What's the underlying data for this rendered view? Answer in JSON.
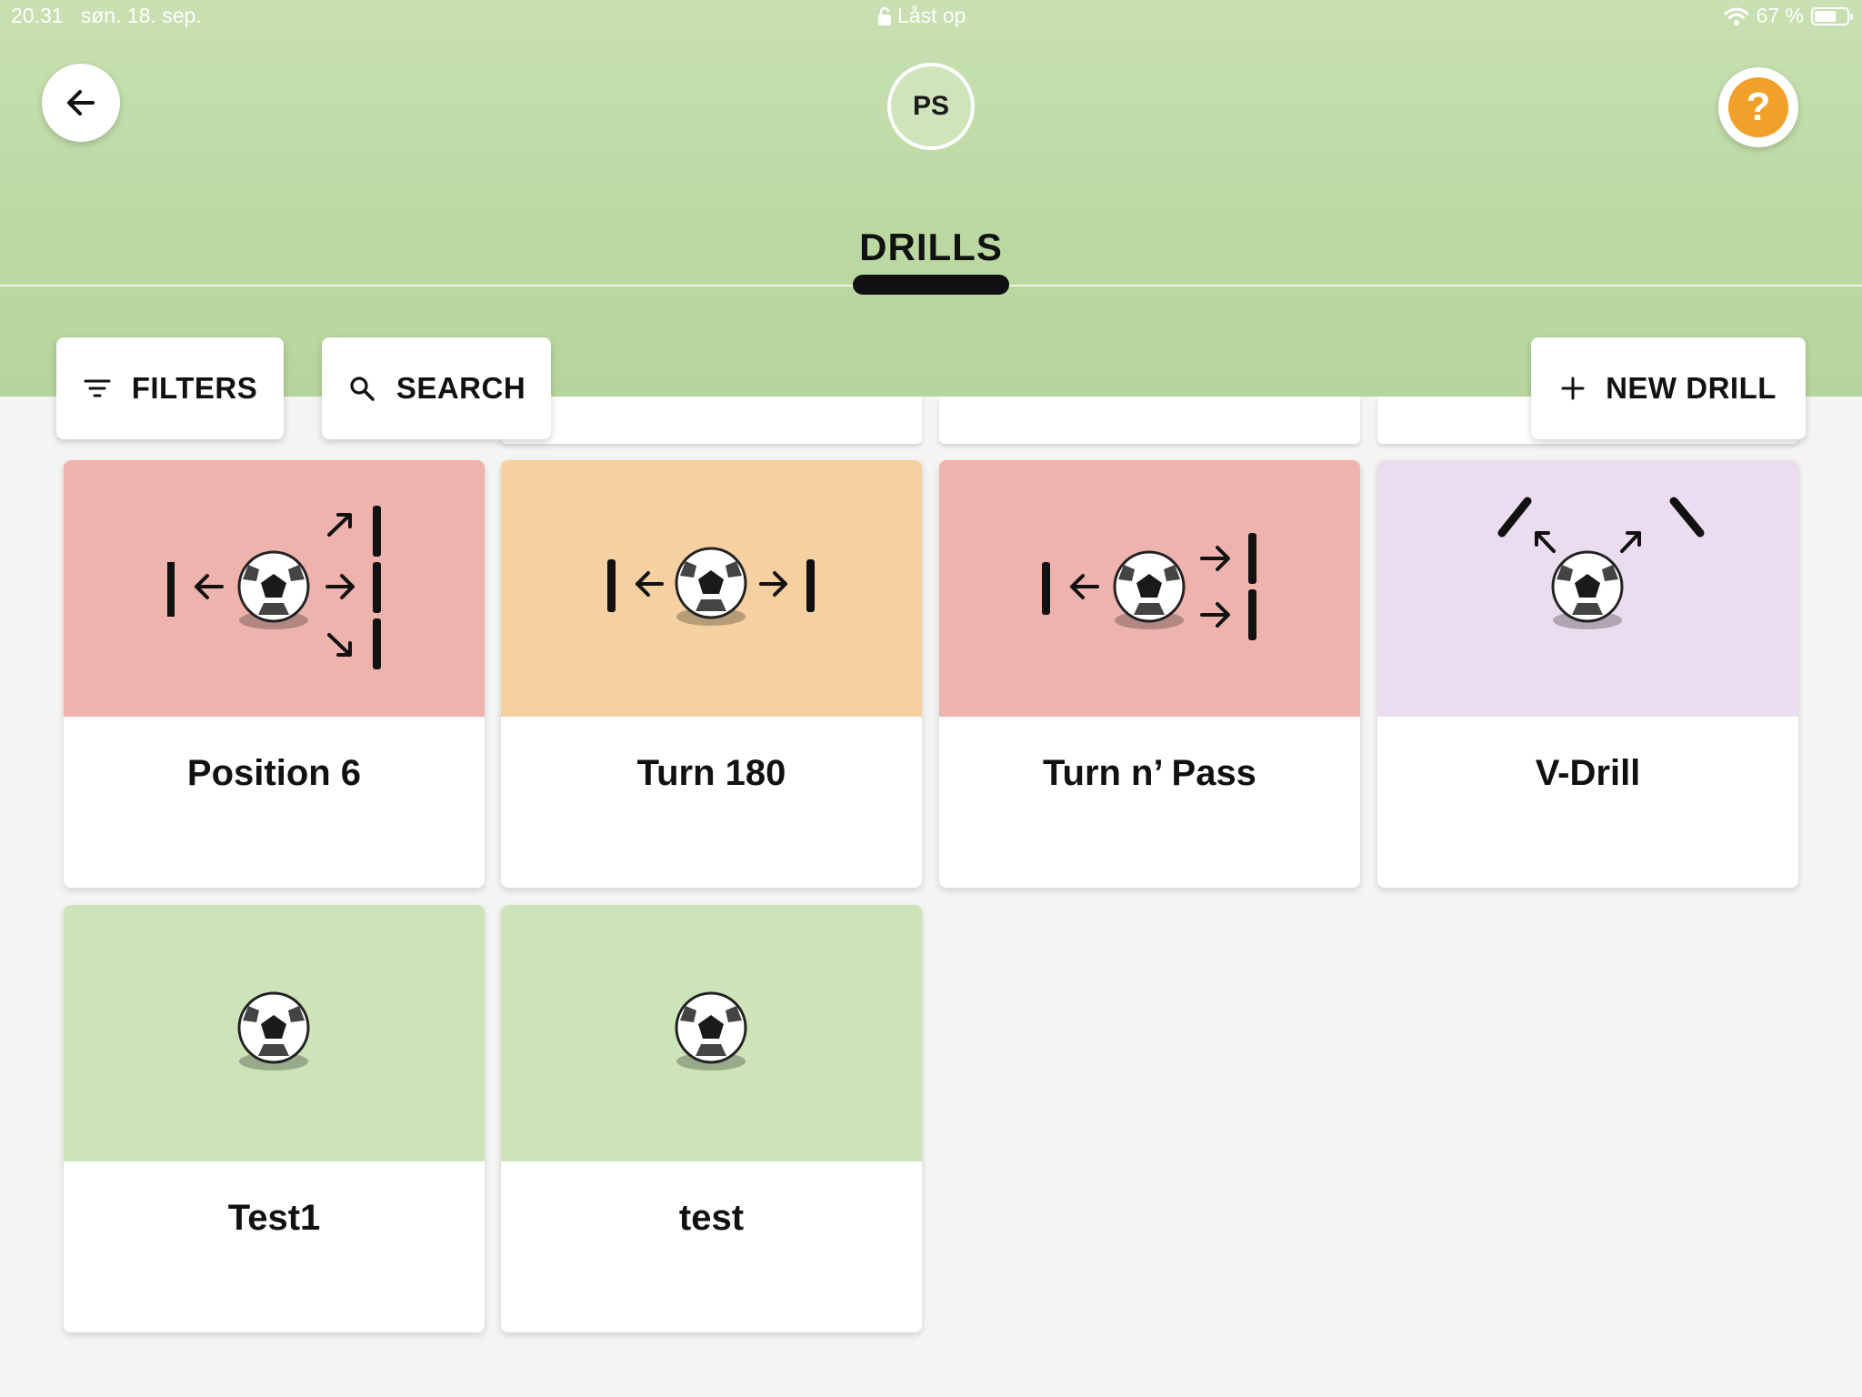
{
  "status_bar": {
    "time": "20.31",
    "date": "søn. 18. sep.",
    "lock_text": "Låst op",
    "battery_text": "67 %",
    "battery_level": 0.67
  },
  "header": {
    "avatar_initials": "PS",
    "help_label": "?",
    "tab_label": "DRILLS"
  },
  "toolbar": {
    "filters_label": "FILTERS",
    "search_label": "SEARCH",
    "new_drill_label": "NEW DRILL"
  },
  "colors": {
    "header_green": "#bcd9a3",
    "card_red": "#eeb3ad",
    "card_orange": "#f5d0a0",
    "card_purple": "#ebdcef",
    "card_green": "#cde3b8",
    "help_orange": "#f1a02a"
  },
  "drills": [
    {
      "title": "Position 6",
      "color": "red",
      "diagram": "ball-left-cone-right-three-cones"
    },
    {
      "title": "Turn 180",
      "color": "orange",
      "diagram": "ball-left-and-right-cones"
    },
    {
      "title": "Turn n’ Pass",
      "color": "red",
      "diagram": "ball-left-cone-right-two-cones"
    },
    {
      "title": "V-Drill",
      "color": "purple",
      "diagram": "ball-v-shape-cones"
    },
    {
      "title": "Test1",
      "color": "green",
      "diagram": "ball-only"
    },
    {
      "title": "test",
      "color": "green",
      "diagram": "ball-only"
    }
  ]
}
